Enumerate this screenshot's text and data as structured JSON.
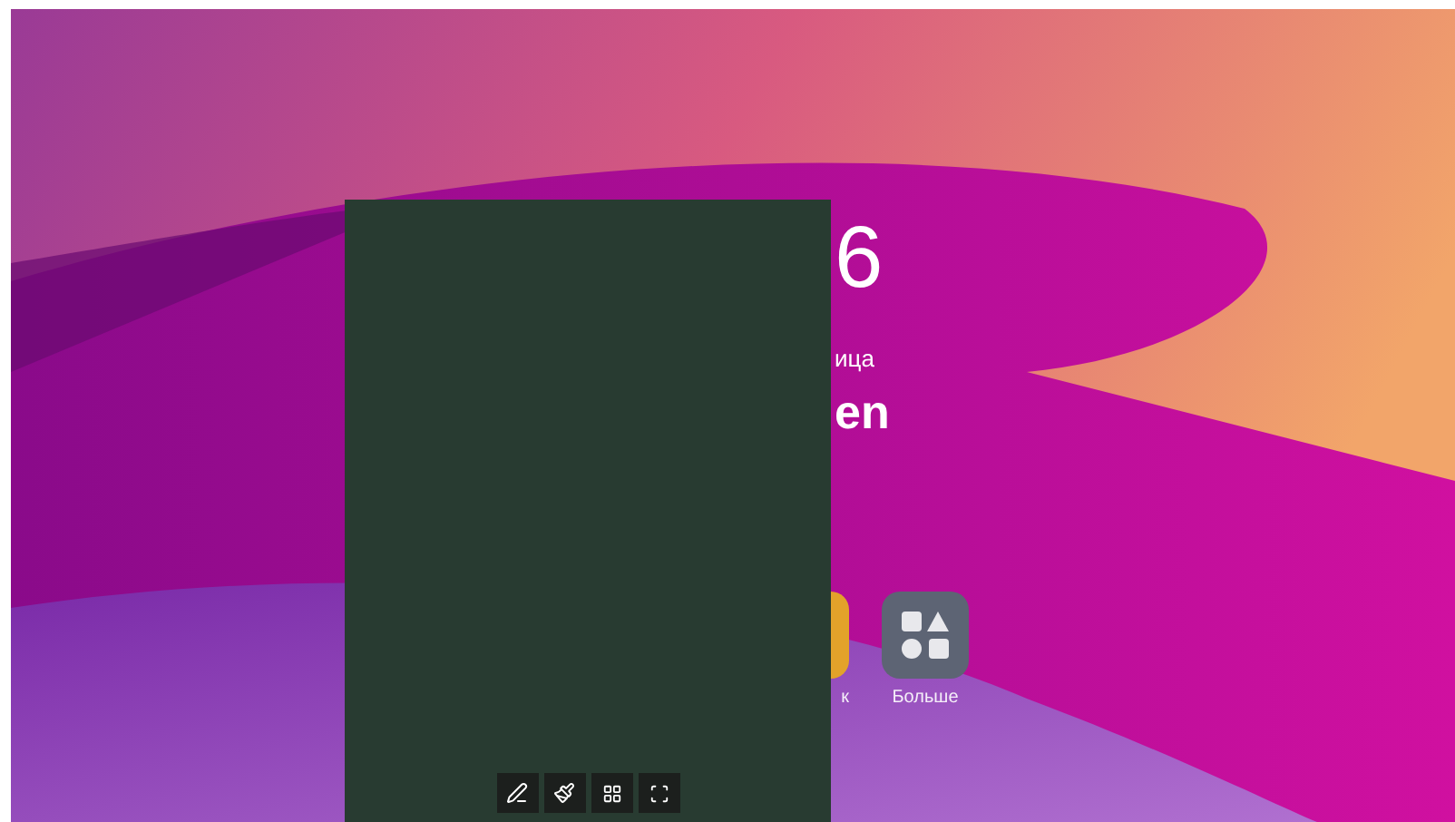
{
  "clock": {
    "time": "6",
    "date": "ица",
    "greeting": "en"
  },
  "apps": [
    {
      "kind": "orange",
      "label": "к"
    },
    {
      "kind": "more",
      "label": "Больше"
    }
  ]
}
